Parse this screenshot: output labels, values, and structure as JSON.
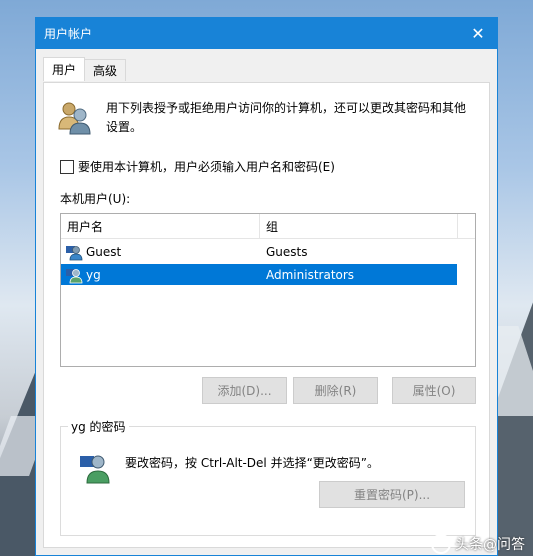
{
  "window": {
    "title": "用户帐户",
    "close_glyph": "✕"
  },
  "tabs": [
    {
      "label": "用户",
      "active": true
    },
    {
      "label": "高级",
      "active": false
    }
  ],
  "info": {
    "description": "用下列表授予或拒绝用户访问你的计算机，还可以更改其密码和其他设置。"
  },
  "require_login": {
    "label": "要使用本计算机，用户必须输入用户名和密码(E)",
    "checked": false
  },
  "local_users": {
    "label": "本机用户(U):",
    "columns": [
      "用户名",
      "组"
    ],
    "rows": [
      {
        "username": "Guest",
        "group": "Guests",
        "selected": false
      },
      {
        "username": "yg",
        "group": "Administrators",
        "selected": true
      }
    ]
  },
  "buttons": {
    "add": "添加(D)...",
    "delete": "删除(R)",
    "properties": "属性(O)"
  },
  "password_group": {
    "legend": "yg 的密码",
    "text": "要改密码，按 Ctrl-Alt-Del 并选择“更改密码”。",
    "reset_button": "重置密码(P)..."
  },
  "watermark": {
    "text": "头条@问答"
  },
  "colors": {
    "titlebar": "#1883d7",
    "selection": "#0078d7"
  },
  "icons": {
    "users": "users-icon",
    "user": "user-icon",
    "password": "password-icon"
  }
}
